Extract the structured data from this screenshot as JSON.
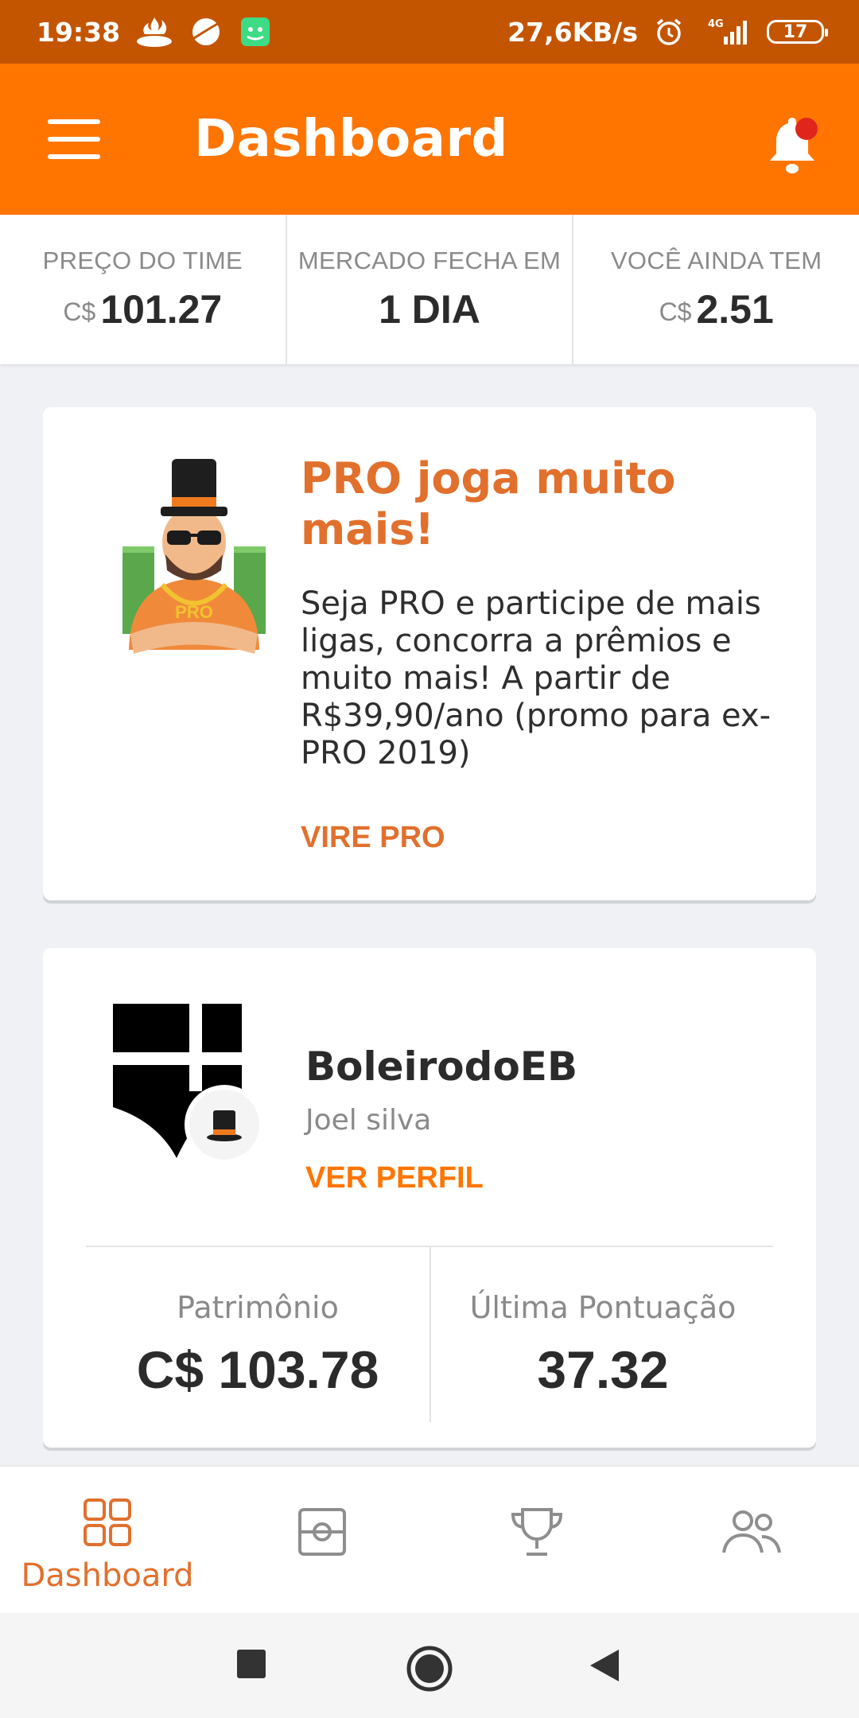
{
  "status_bar": {
    "time": "19:38",
    "network_speed": "27,6KB/s",
    "network_type": "4G",
    "battery": "17",
    "icons": [
      "santander-icon",
      "planet-icon",
      "android-robot-icon",
      "alarm-icon",
      "signal-icon",
      "battery-icon"
    ]
  },
  "app_bar": {
    "title": "Dashboard",
    "menu_icon": "hamburger-menu-icon",
    "notification_icon": "bell-icon",
    "notification_dot_color": "#E0261C"
  },
  "stats": [
    {
      "label": "PREÇO DO TIME",
      "prefix": "C$",
      "value": "101.27"
    },
    {
      "label": "MERCADO FECHA EM",
      "prefix": "",
      "value": "1 DIA"
    },
    {
      "label": "VOCÊ AINDA TEM",
      "prefix": "C$",
      "value": "2.51"
    }
  ],
  "promo_card": {
    "title": "PRO joga muito mais!",
    "text": "Seja PRO e participe de mais ligas, concorra a prêmios e muito mais! A partir de R$39,90/ano (promo para ex-PRO 2019)",
    "cta": "VIRE PRO",
    "mascot_badge": "PRO"
  },
  "profile_card": {
    "team_name": "BoleirodoEB",
    "owner_name": "Joel silva",
    "link": "VER PERFIL",
    "metrics": [
      {
        "label": "Patrimônio",
        "value": "C$ 103.78"
      },
      {
        "label": "Última Pontuação",
        "value": "37.32"
      }
    ]
  },
  "bottom_nav": {
    "items": [
      {
        "label": "Dashboard",
        "icon": "dashboard-grid-icon",
        "active": true
      },
      {
        "label": "",
        "icon": "field-icon",
        "active": false
      },
      {
        "label": "",
        "icon": "trophy-icon",
        "active": false
      },
      {
        "label": "",
        "icon": "people-icon",
        "active": false
      }
    ]
  },
  "colors": {
    "status_bar": "#C45500",
    "app_bar": "#FF7500",
    "accent": "#E1702D",
    "background": "#EFF1F4"
  }
}
